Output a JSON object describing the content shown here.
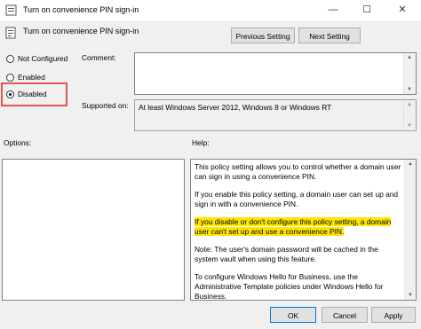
{
  "window": {
    "title": "Turn on convenience PIN sign-in",
    "controls": [
      "—",
      "☐",
      "✕"
    ]
  },
  "header": {
    "policy_name": "Turn on convenience PIN sign-in",
    "prev_label": "Previous Setting",
    "next_label": "Next Setting"
  },
  "state": {
    "options": [
      {
        "label": "Not Configured",
        "selected": false
      },
      {
        "label": "Enabled",
        "selected": false
      },
      {
        "label": "Disabled",
        "selected": true
      }
    ],
    "highlight_color": "#e2574c"
  },
  "fields": {
    "comment_label": "Comment:",
    "comment_value": "",
    "supported_label": "Supported on:",
    "supported_value": "At least Windows Server 2012, Windows 8 or Windows RT"
  },
  "panes": {
    "options_label": "Options:",
    "help_label": "Help:",
    "help_paragraphs": [
      "This policy setting allows you to control whether a domain user can sign in using a convenience PIN.",
      "If you enable this policy setting, a domain user can set up and sign in with a convenience PIN.",
      "If you disable or don't configure this policy setting, a domain user can't set up and use a convenience PIN.",
      "Note: The user's domain password will be cached in the system vault when using this feature.",
      "To configure Windows Hello for Business, use the Administrative Template policies under Windows Hello for Business."
    ],
    "help_highlight_color": "#ffe600"
  },
  "footer": {
    "ok_label": "OK",
    "cancel_label": "Cancel",
    "apply_label": "Apply"
  }
}
